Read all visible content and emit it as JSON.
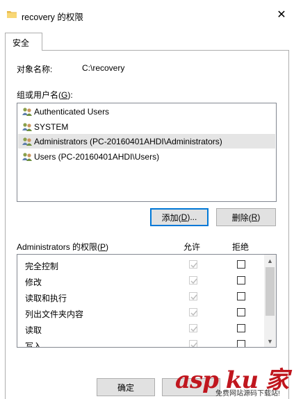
{
  "window": {
    "title": "recovery 的权限",
    "close_glyph": "✕"
  },
  "tabs": [
    {
      "label": "安全"
    }
  ],
  "object": {
    "label": "对象名称:",
    "value": "C:\\recovery"
  },
  "groups": {
    "label_prefix": "组或用户名(",
    "label_key": "G",
    "label_suffix": "):",
    "items": [
      {
        "name": "Authenticated Users",
        "icon": "users-icon",
        "selected": false
      },
      {
        "name": "SYSTEM",
        "icon": "users-icon",
        "selected": false
      },
      {
        "name": "Administrators (PC-20160401AHDI\\Administrators)",
        "icon": "users-icon",
        "selected": true
      },
      {
        "name": "Users (PC-20160401AHDI\\Users)",
        "icon": "users-icon",
        "selected": false
      }
    ]
  },
  "buttons": {
    "add_prefix": "添加(",
    "add_key": "D",
    "add_suffix": ")...",
    "remove_prefix": "删除(",
    "remove_key": "R",
    "remove_suffix": ")",
    "ok": "确定"
  },
  "permissions": {
    "title_prefix": "Administrators 的权限(",
    "title_key": "P",
    "title_suffix": ")",
    "allow_header": "允许",
    "deny_header": "拒绝",
    "rows": [
      {
        "name": "完全控制",
        "allow": true,
        "deny": false
      },
      {
        "name": "修改",
        "allow": true,
        "deny": false
      },
      {
        "name": "读取和执行",
        "allow": true,
        "deny": false
      },
      {
        "name": "列出文件夹内容",
        "allow": true,
        "deny": false
      },
      {
        "name": "读取",
        "allow": true,
        "deny": false
      },
      {
        "name": "写入",
        "allow": true,
        "deny": false
      }
    ]
  },
  "watermark": {
    "main": "asp ku 家",
    "sub": "免费网站源码下载站!"
  },
  "colors": {
    "accent": "#0078d7",
    "selection": "#e5e5e5",
    "watermark": "#c0161e"
  }
}
